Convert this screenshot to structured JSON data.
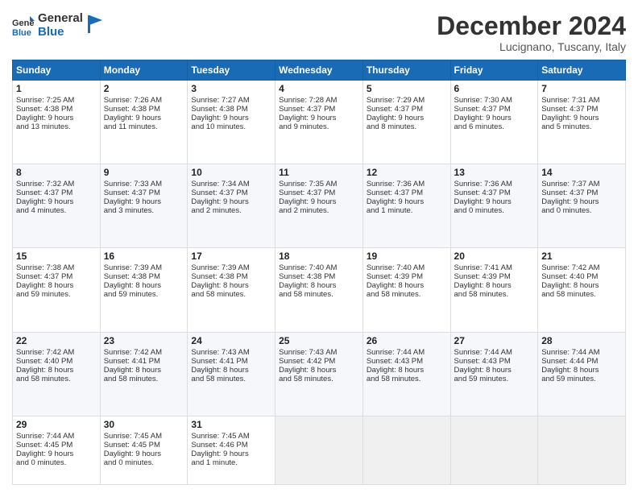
{
  "header": {
    "logo_line1": "General",
    "logo_line2": "Blue",
    "month_title": "December 2024",
    "location": "Lucignano, Tuscany, Italy"
  },
  "weekdays": [
    "Sunday",
    "Monday",
    "Tuesday",
    "Wednesday",
    "Thursday",
    "Friday",
    "Saturday"
  ],
  "weeks": [
    [
      {
        "day": "1",
        "lines": [
          "Sunrise: 7:25 AM",
          "Sunset: 4:38 PM",
          "Daylight: 9 hours",
          "and 13 minutes."
        ]
      },
      {
        "day": "2",
        "lines": [
          "Sunrise: 7:26 AM",
          "Sunset: 4:38 PM",
          "Daylight: 9 hours",
          "and 11 minutes."
        ]
      },
      {
        "day": "3",
        "lines": [
          "Sunrise: 7:27 AM",
          "Sunset: 4:38 PM",
          "Daylight: 9 hours",
          "and 10 minutes."
        ]
      },
      {
        "day": "4",
        "lines": [
          "Sunrise: 7:28 AM",
          "Sunset: 4:37 PM",
          "Daylight: 9 hours",
          "and 9 minutes."
        ]
      },
      {
        "day": "5",
        "lines": [
          "Sunrise: 7:29 AM",
          "Sunset: 4:37 PM",
          "Daylight: 9 hours",
          "and 8 minutes."
        ]
      },
      {
        "day": "6",
        "lines": [
          "Sunrise: 7:30 AM",
          "Sunset: 4:37 PM",
          "Daylight: 9 hours",
          "and 6 minutes."
        ]
      },
      {
        "day": "7",
        "lines": [
          "Sunrise: 7:31 AM",
          "Sunset: 4:37 PM",
          "Daylight: 9 hours",
          "and 5 minutes."
        ]
      }
    ],
    [
      {
        "day": "8",
        "lines": [
          "Sunrise: 7:32 AM",
          "Sunset: 4:37 PM",
          "Daylight: 9 hours",
          "and 4 minutes."
        ]
      },
      {
        "day": "9",
        "lines": [
          "Sunrise: 7:33 AM",
          "Sunset: 4:37 PM",
          "Daylight: 9 hours",
          "and 3 minutes."
        ]
      },
      {
        "day": "10",
        "lines": [
          "Sunrise: 7:34 AM",
          "Sunset: 4:37 PM",
          "Daylight: 9 hours",
          "and 2 minutes."
        ]
      },
      {
        "day": "11",
        "lines": [
          "Sunrise: 7:35 AM",
          "Sunset: 4:37 PM",
          "Daylight: 9 hours",
          "and 2 minutes."
        ]
      },
      {
        "day": "12",
        "lines": [
          "Sunrise: 7:36 AM",
          "Sunset: 4:37 PM",
          "Daylight: 9 hours",
          "and 1 minute."
        ]
      },
      {
        "day": "13",
        "lines": [
          "Sunrise: 7:36 AM",
          "Sunset: 4:37 PM",
          "Daylight: 9 hours",
          "and 0 minutes."
        ]
      },
      {
        "day": "14",
        "lines": [
          "Sunrise: 7:37 AM",
          "Sunset: 4:37 PM",
          "Daylight: 9 hours",
          "and 0 minutes."
        ]
      }
    ],
    [
      {
        "day": "15",
        "lines": [
          "Sunrise: 7:38 AM",
          "Sunset: 4:37 PM",
          "Daylight: 8 hours",
          "and 59 minutes."
        ]
      },
      {
        "day": "16",
        "lines": [
          "Sunrise: 7:39 AM",
          "Sunset: 4:38 PM",
          "Daylight: 8 hours",
          "and 59 minutes."
        ]
      },
      {
        "day": "17",
        "lines": [
          "Sunrise: 7:39 AM",
          "Sunset: 4:38 PM",
          "Daylight: 8 hours",
          "and 58 minutes."
        ]
      },
      {
        "day": "18",
        "lines": [
          "Sunrise: 7:40 AM",
          "Sunset: 4:38 PM",
          "Daylight: 8 hours",
          "and 58 minutes."
        ]
      },
      {
        "day": "19",
        "lines": [
          "Sunrise: 7:40 AM",
          "Sunset: 4:39 PM",
          "Daylight: 8 hours",
          "and 58 minutes."
        ]
      },
      {
        "day": "20",
        "lines": [
          "Sunrise: 7:41 AM",
          "Sunset: 4:39 PM",
          "Daylight: 8 hours",
          "and 58 minutes."
        ]
      },
      {
        "day": "21",
        "lines": [
          "Sunrise: 7:42 AM",
          "Sunset: 4:40 PM",
          "Daylight: 8 hours",
          "and 58 minutes."
        ]
      }
    ],
    [
      {
        "day": "22",
        "lines": [
          "Sunrise: 7:42 AM",
          "Sunset: 4:40 PM",
          "Daylight: 8 hours",
          "and 58 minutes."
        ]
      },
      {
        "day": "23",
        "lines": [
          "Sunrise: 7:42 AM",
          "Sunset: 4:41 PM",
          "Daylight: 8 hours",
          "and 58 minutes."
        ]
      },
      {
        "day": "24",
        "lines": [
          "Sunrise: 7:43 AM",
          "Sunset: 4:41 PM",
          "Daylight: 8 hours",
          "and 58 minutes."
        ]
      },
      {
        "day": "25",
        "lines": [
          "Sunrise: 7:43 AM",
          "Sunset: 4:42 PM",
          "Daylight: 8 hours",
          "and 58 minutes."
        ]
      },
      {
        "day": "26",
        "lines": [
          "Sunrise: 7:44 AM",
          "Sunset: 4:43 PM",
          "Daylight: 8 hours",
          "and 58 minutes."
        ]
      },
      {
        "day": "27",
        "lines": [
          "Sunrise: 7:44 AM",
          "Sunset: 4:43 PM",
          "Daylight: 8 hours",
          "and 59 minutes."
        ]
      },
      {
        "day": "28",
        "lines": [
          "Sunrise: 7:44 AM",
          "Sunset: 4:44 PM",
          "Daylight: 8 hours",
          "and 59 minutes."
        ]
      }
    ],
    [
      {
        "day": "29",
        "lines": [
          "Sunrise: 7:44 AM",
          "Sunset: 4:45 PM",
          "Daylight: 9 hours",
          "and 0 minutes."
        ]
      },
      {
        "day": "30",
        "lines": [
          "Sunrise: 7:45 AM",
          "Sunset: 4:45 PM",
          "Daylight: 9 hours",
          "and 0 minutes."
        ]
      },
      {
        "day": "31",
        "lines": [
          "Sunrise: 7:45 AM",
          "Sunset: 4:46 PM",
          "Daylight: 9 hours",
          "and 1 minute."
        ]
      },
      {
        "day": "",
        "lines": []
      },
      {
        "day": "",
        "lines": []
      },
      {
        "day": "",
        "lines": []
      },
      {
        "day": "",
        "lines": []
      }
    ]
  ]
}
